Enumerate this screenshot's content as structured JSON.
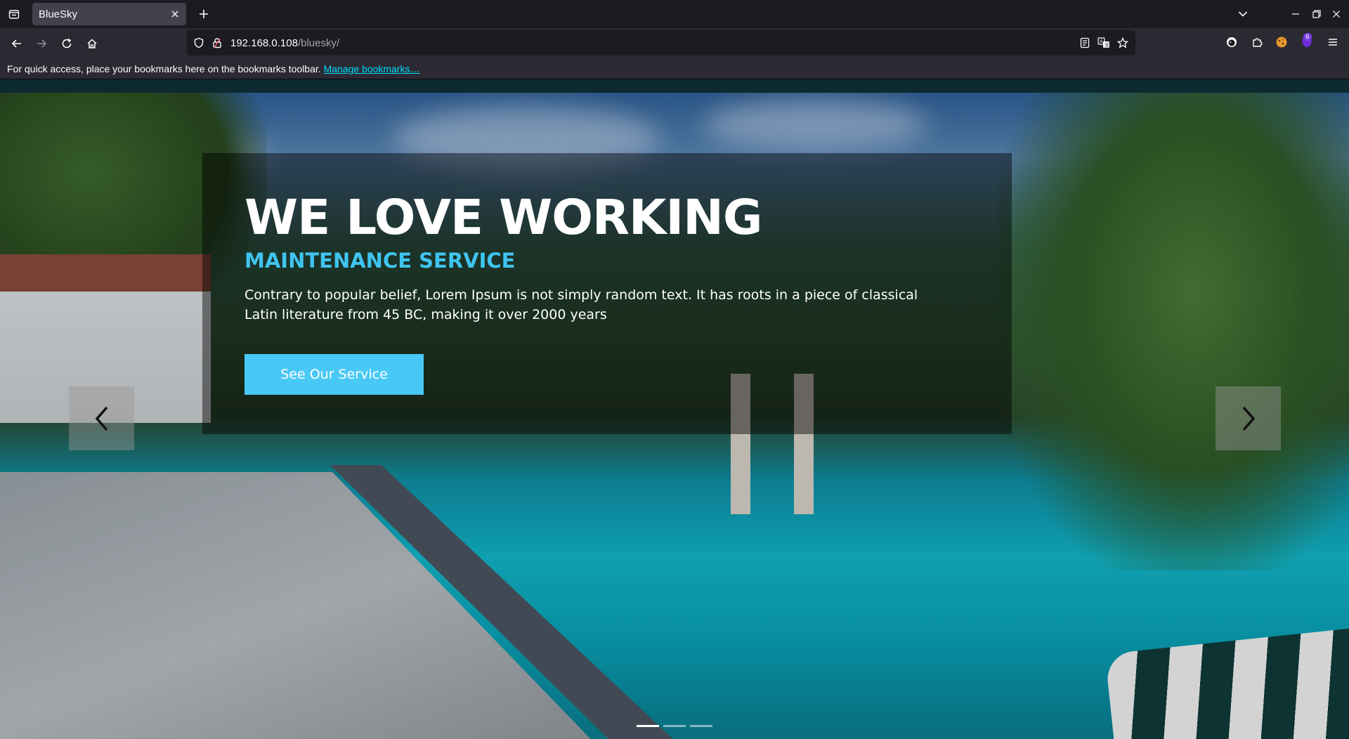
{
  "browser": {
    "tab": {
      "title": "BlueSky"
    },
    "url": {
      "host": "192.168.0.108",
      "path": "/bluesky/"
    },
    "bookmarks_bar": {
      "message": "For quick access, place your bookmarks here on the bookmarks toolbar.",
      "link": "Manage bookmarks…"
    },
    "extension_badge": "6",
    "icons": [
      "tab-list-icon",
      "close-icon",
      "plus-icon",
      "chevron-down-icon",
      "minimize-icon",
      "restore-icon",
      "close-window-icon",
      "back-icon",
      "forward-icon",
      "reload-icon",
      "home-icon",
      "shield-icon",
      "lock-icon",
      "reader-view-icon",
      "translate-icon",
      "star-icon",
      "extension-icon",
      "puzzle-icon",
      "cookie-icon",
      "shield-badge-icon",
      "menu-icon"
    ]
  },
  "hero": {
    "headline": "WE LOVE WORKING",
    "subheadline": "MAINTENANCE SERVICE",
    "description": "Contrary to popular belief, Lorem Ipsum is not simply random text. It has roots in a piece of classical Latin literature from 45 BC, making it over 2000 years",
    "cta_label": "See Our Service",
    "accent_color": "#48c8f5",
    "slides": {
      "count": 3,
      "active_index": 0
    }
  }
}
